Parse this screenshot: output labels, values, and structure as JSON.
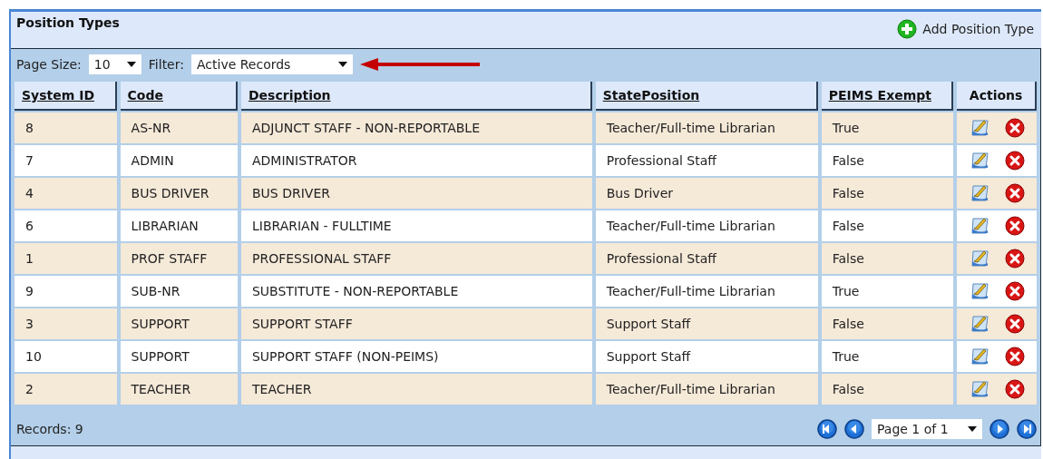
{
  "panel": {
    "title": "Position Types",
    "add_button": "Add Position Type"
  },
  "toolbar": {
    "page_size_label": "Page Size:",
    "page_size": "10",
    "filter_label": "Filter:",
    "filter": "Active Records"
  },
  "table": {
    "columns": [
      {
        "label": "System ID",
        "sortable": true
      },
      {
        "label": "Code",
        "sortable": true
      },
      {
        "label": "Description",
        "sortable": true
      },
      {
        "label": "StatePosition",
        "sortable": true
      },
      {
        "label": "PEIMS Exempt",
        "sortable": true
      },
      {
        "label": "Actions",
        "sortable": false
      }
    ],
    "rows": [
      [
        "8",
        "AS-NR",
        "ADJUNCT STAFF - NON-REPORTABLE",
        "Teacher/Full-time Librarian",
        "True"
      ],
      [
        "7",
        "ADMIN",
        "ADMINISTRATOR",
        "Professional Staff",
        "False"
      ],
      [
        "4",
        "BUS DRIVER",
        "BUS DRIVER",
        "Bus Driver",
        "False"
      ],
      [
        "6",
        "LIBRARIAN",
        "LIBRARIAN - FULLTIME",
        "Teacher/Full-time Librarian",
        "False"
      ],
      [
        "1",
        "PROF STAFF",
        "PROFESSIONAL STAFF",
        "Professional Staff",
        "False"
      ],
      [
        "9",
        "SUB-NR",
        "SUBSTITUTE - NON-REPORTABLE",
        "Teacher/Full-time Librarian",
        "True"
      ],
      [
        "3",
        "SUPPORT",
        "SUPPORT STAFF",
        "Support Staff",
        "False"
      ],
      [
        "10",
        "SUPPORT",
        "SUPPORT STAFF (NON-PEIMS)",
        "Support Staff",
        "True"
      ],
      [
        "2",
        "TEACHER",
        "TEACHER",
        "Teacher/Full-time Librarian",
        "False"
      ]
    ]
  },
  "footer": {
    "records": "Records: 9",
    "page": "Page 1 of 1"
  }
}
